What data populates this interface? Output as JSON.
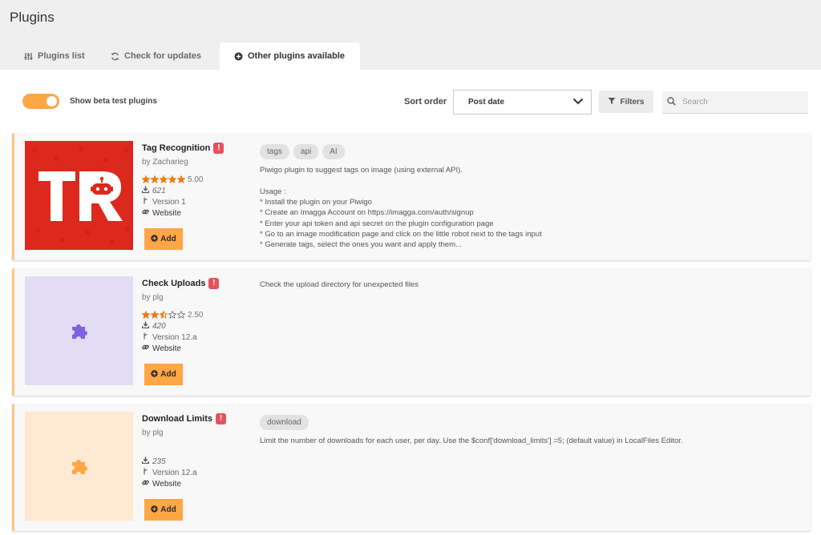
{
  "page": {
    "title": "Plugins"
  },
  "tabs": [
    {
      "label": "Plugins list"
    },
    {
      "label": "Check for updates"
    },
    {
      "label": "Other plugins available"
    }
  ],
  "toolbar": {
    "beta_toggle_label": "Show beta test plugins",
    "beta_toggle_on": true,
    "sort_label": "Sort order",
    "sort_value": "Post date",
    "filters_label": "Filters",
    "search_placeholder": "Search"
  },
  "colors": {
    "accent": "#ffa646",
    "card_border": "#ffc78a",
    "warning": "#e8505b",
    "star": "#f07c10"
  },
  "plugins": [
    {
      "name": "Tag Recognition",
      "author": "by Zacharieg",
      "stars": 5,
      "rating": "5.00",
      "downloads": "621",
      "version": "Version 1",
      "website_label": "Website",
      "add_label": "Add",
      "thumb_icon": "tag-recognition-logo",
      "thumb_text": "TR",
      "tags": [
        "tags",
        "api",
        "AI"
      ],
      "description": [
        "Piwigo plugin to suggest tags on image (using external API).",
        "",
        "Usage :",
        "* Install the plugin on your Piwigo",
        "* Create an Imagga Account on https://imagga.com/auth/signup",
        "* Enter your api token and api secret on the plugin configuration page",
        "* Go to an image modification page and click on the little robot next to the tags input",
        "* Generate tags, select the ones you want and apply them..."
      ]
    },
    {
      "name": "Check Uploads",
      "author": "by plg",
      "stars": 2.5,
      "rating": "2.50",
      "downloads": "420",
      "version": "Version 12.a",
      "website_label": "Website",
      "add_label": "Add",
      "thumb_icon": "puzzle-icon",
      "tags": [],
      "description": [
        "Check the upload directory for unexpected files"
      ]
    },
    {
      "name": "Download Limits",
      "author": "by plg",
      "stars": null,
      "rating": "",
      "downloads": "235",
      "version": "Version 12.a",
      "website_label": "Website",
      "add_label": "Add",
      "thumb_icon": "puzzle-icon",
      "tags": [
        "download"
      ],
      "description": [
        "Limit the number of downloads for each user, per day. Use the $conf['download_limits'] =5; (default value) in LocalFiles Editor."
      ]
    }
  ]
}
